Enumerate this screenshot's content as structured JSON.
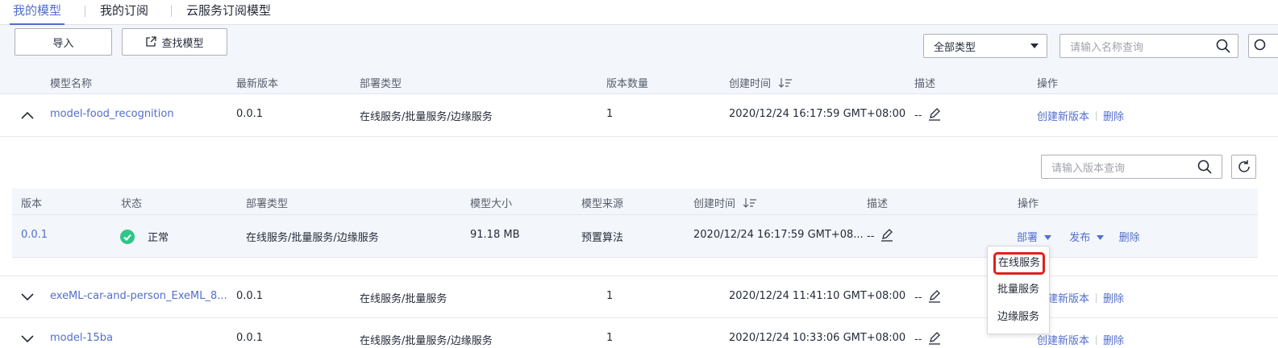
{
  "tabs": [
    {
      "label": "我的模型"
    },
    {
      "label": "我的订阅"
    },
    {
      "label": "云服务订阅模型"
    }
  ],
  "toolbar": {
    "import_label": "导入",
    "find_model_label": "查找模型",
    "type_filter_value": "全部类型",
    "search_placeholder": "请输入名称查询"
  },
  "table": {
    "headers": {
      "name": "模型名称",
      "latest_version": "最新版本",
      "deploy_type": "部署类型",
      "version_count": "版本数量",
      "created": "创建时间",
      "desc": "描述",
      "ops": "操作"
    },
    "rows": [
      {
        "name": "model-food_recognition",
        "version": "0.0.1",
        "deploy_type": "在线服务/批量服务/边缘服务",
        "count": "1",
        "created": "2020/12/24 16:17:59 GMT+08:00",
        "desc": "--",
        "op_create": "创建新版本",
        "op_delete": "删除"
      },
      {
        "name": "exeML-car-and-person_ExeML_8...",
        "version": "0.0.1",
        "deploy_type": "在线服务/批量服务",
        "count": "1",
        "created": "2020/12/24 11:41:10 GMT+08:00",
        "desc": "--",
        "op_create": "创建新版本",
        "op_delete": "删除"
      },
      {
        "name": "model-15ba",
        "version": "0.0.1",
        "deploy_type": "在线服务/批量服务/边缘服务",
        "count": "1",
        "created": "2020/12/24 10:33:06 GMT+08:00",
        "desc": "--",
        "op_create": "创建新版本",
        "op_delete": "删除"
      }
    ]
  },
  "subtable": {
    "search_placeholder": "请输入版本查询",
    "headers": {
      "version": "版本",
      "status": "状态",
      "deploy_type": "部署类型",
      "size": "模型大小",
      "source": "模型来源",
      "created": "创建时间",
      "desc": "描述",
      "ops": "操作"
    },
    "row": {
      "version": "0.0.1",
      "status": "正常",
      "deploy_type": "在线服务/批量服务/边缘服务",
      "size": "91.18 MB",
      "source": "预置算法",
      "created": "2020/12/24 16:17:59 GMT+08...",
      "desc": "--",
      "op_deploy": "部署",
      "op_publish": "发布",
      "op_delete": "删除"
    }
  },
  "deploy_menu": {
    "items": [
      "在线服务",
      "批量服务",
      "边缘服务"
    ]
  },
  "colors": {
    "accent": "#526ecc",
    "status_ok": "#2ec78a",
    "highlight": "#e0201b"
  }
}
